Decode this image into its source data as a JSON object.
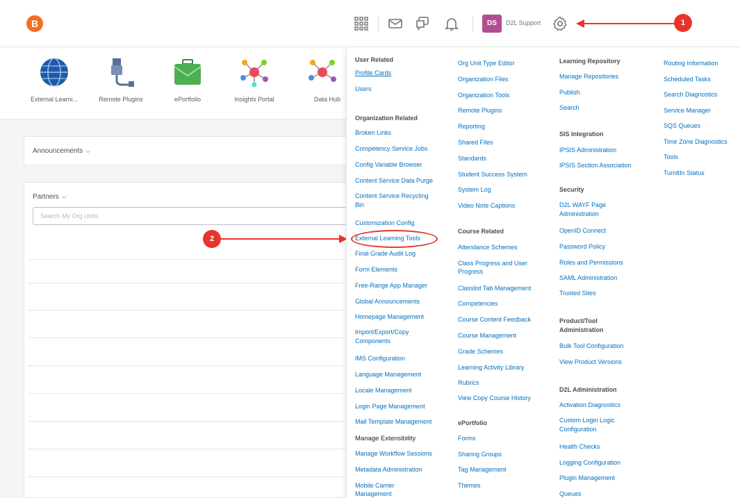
{
  "topbar": {
    "logo_letter": "B",
    "user_initials": "DS",
    "user_name": "D2L Support",
    "callout_1": "1",
    "callout_2": "2"
  },
  "tools": [
    {
      "label": "External Learni...",
      "icon": "globe-icon"
    },
    {
      "label": "Remote Plugins",
      "icon": "plug-icon"
    },
    {
      "label": "ePortfolio",
      "icon": "briefcase-icon"
    },
    {
      "label": "Insights Portal",
      "icon": "network-icon"
    },
    {
      "label": "Data Hub",
      "icon": "network-icon"
    }
  ],
  "panels": {
    "announcements": "Announcements",
    "partners": "Partners",
    "search_placeholder": "Search My Org Units"
  },
  "menu": {
    "col1": [
      {
        "text": "User Related",
        "type": "heading"
      },
      {
        "text": "Profile Cards",
        "type": "link-underline"
      },
      {
        "text": "Users",
        "type": "link"
      },
      {
        "text": "Organization Related",
        "type": "heading"
      },
      {
        "text": "Broken Links",
        "type": "link"
      },
      {
        "text": "Competency Service Jobs",
        "type": "link"
      },
      {
        "text": "Config Variable Browser",
        "type": "link"
      },
      {
        "text": "Content Service Data Purge",
        "type": "link"
      },
      {
        "text": "Content Service Recycling",
        "type": "link"
      },
      {
        "text": "Bin",
        "type": "link"
      },
      {
        "text": "Customization Config",
        "type": "link"
      },
      {
        "text": "External Learning Tools",
        "type": "link"
      },
      {
        "text": "Final Grade Audit Log",
        "type": "link"
      },
      {
        "text": "Form Elements",
        "type": "link"
      },
      {
        "text": "Free-Range App Manager",
        "type": "link"
      },
      {
        "text": "Global Announcements",
        "type": "link"
      },
      {
        "text": "Homepage Management",
        "type": "link"
      },
      {
        "text": "Import/Export/Copy",
        "type": "link"
      },
      {
        "text": "Components",
        "type": "link"
      },
      {
        "text": "IMS Configuration",
        "type": "link"
      },
      {
        "text": "Language Management",
        "type": "link"
      },
      {
        "text": "Locale Management",
        "type": "link"
      },
      {
        "text": "Login Page Management",
        "type": "link"
      },
      {
        "text": "Mail Template Management",
        "type": "link"
      },
      {
        "text": "Manage Extensibility",
        "type": "dark"
      },
      {
        "text": "Manage Workflow Sessions",
        "type": "link"
      },
      {
        "text": "Metadata Administration",
        "type": "link"
      },
      {
        "text": "Mobile Carrier",
        "type": "link"
      },
      {
        "text": "Management",
        "type": "link"
      }
    ],
    "col2": [
      {
        "text": "Org Unit Type Editor",
        "type": "link"
      },
      {
        "text": "Organization Files",
        "type": "link"
      },
      {
        "text": "Organization Tools",
        "type": "link"
      },
      {
        "text": "Remote Plugins",
        "type": "link"
      },
      {
        "text": "Reporting",
        "type": "link"
      },
      {
        "text": "Shared Files",
        "type": "link"
      },
      {
        "text": "Standards",
        "type": "link"
      },
      {
        "text": "Student Success System",
        "type": "link"
      },
      {
        "text": "System Log",
        "type": "link"
      },
      {
        "text": "Video Note Captions",
        "type": "link"
      },
      {
        "text": "Course Related",
        "type": "heading"
      },
      {
        "text": "Attendance Schemes",
        "type": "link"
      },
      {
        "text": "Class Progress and User",
        "type": "link"
      },
      {
        "text": "Progress",
        "type": "link"
      },
      {
        "text": "Classlist Tab Management",
        "type": "link"
      },
      {
        "text": "Competencies",
        "type": "link"
      },
      {
        "text": "Course Content Feedback",
        "type": "link"
      },
      {
        "text": "Course Management",
        "type": "link"
      },
      {
        "text": "Grade Schemes",
        "type": "link"
      },
      {
        "text": "Learning Activity Library",
        "type": "link"
      },
      {
        "text": "Rubrics",
        "type": "link"
      },
      {
        "text": "View Copy Course History",
        "type": "link"
      },
      {
        "text": "ePortfolio",
        "type": "heading"
      },
      {
        "text": "Forms",
        "type": "link"
      },
      {
        "text": "Sharing Groups",
        "type": "link"
      },
      {
        "text": "Tag Management",
        "type": "link"
      },
      {
        "text": "Themes",
        "type": "link"
      }
    ],
    "col3": [
      {
        "text": "Learning Repository",
        "type": "heading"
      },
      {
        "text": "Manage Repositories",
        "type": "link"
      },
      {
        "text": "Publish",
        "type": "link"
      },
      {
        "text": "Search",
        "type": "link"
      },
      {
        "text": "SIS Integration",
        "type": "heading"
      },
      {
        "text": "IPSIS Administration",
        "type": "link"
      },
      {
        "text": "IPSIS Section Association",
        "type": "link"
      },
      {
        "text": "Security",
        "type": "heading"
      },
      {
        "text": "D2L WAYF Page",
        "type": "link"
      },
      {
        "text": "Administration",
        "type": "link"
      },
      {
        "text": "OpenID Connect",
        "type": "link"
      },
      {
        "text": "Password Policy",
        "type": "link"
      },
      {
        "text": "Roles and Permissions",
        "type": "link"
      },
      {
        "text": "SAML Administration",
        "type": "link"
      },
      {
        "text": "Trusted Sites",
        "type": "link"
      },
      {
        "text": "Product/Tool",
        "type": "heading"
      },
      {
        "text": "Administration",
        "type": "heading"
      },
      {
        "text": "Bulk Tool Configuration",
        "type": "link"
      },
      {
        "text": "View Product Versions",
        "type": "link"
      },
      {
        "text": "D2L Administration",
        "type": "heading"
      },
      {
        "text": "Activation Diagnostics",
        "type": "link"
      },
      {
        "text": "Custom Login Logic",
        "type": "link"
      },
      {
        "text": "Configuration",
        "type": "link"
      },
      {
        "text": "Health Checks",
        "type": "link"
      },
      {
        "text": "Logging Configuration",
        "type": "link"
      },
      {
        "text": "Plugin Management",
        "type": "link"
      },
      {
        "text": "Queues",
        "type": "link"
      }
    ],
    "col4": [
      {
        "text": "Routing Information",
        "type": "link"
      },
      {
        "text": "Scheduled Tasks",
        "type": "link"
      },
      {
        "text": "Search Diagnostics",
        "type": "link"
      },
      {
        "text": "Service Manager",
        "type": "link"
      },
      {
        "text": "SQS Queues",
        "type": "link"
      },
      {
        "text": "Time Zone Diagnostics",
        "type": "link"
      },
      {
        "text": "Tools",
        "type": "link"
      },
      {
        "text": "TurnItIn Status",
        "type": "link"
      }
    ]
  },
  "colors": {
    "link": "#006fbf",
    "accent_red": "#e8342b",
    "logo_orange": "#f26e22",
    "badge_purple": "#b24d91"
  }
}
